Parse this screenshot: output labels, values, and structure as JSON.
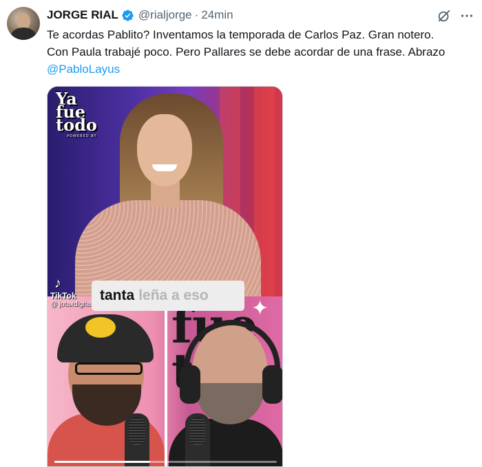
{
  "author": {
    "name": "JORGE RIAL",
    "handle": "@rialjorge",
    "separator": "·",
    "time": "24min"
  },
  "tweet": {
    "line1": "Te acordas Pablito? Inventamos la temporada de Carlos Paz. Gran notero.",
    "line2": "Con Paula trabajé poco. Pero Pallares se debe acordar de una frase. Abrazo",
    "mention": "@PabloLayus"
  },
  "media": {
    "logo_line1": "Ya",
    "logo_line2": "fue",
    "logo_line3": "todo",
    "logo_sub": "POWERED BY",
    "caption_dark": "tanta",
    "caption_light": "leña a eso",
    "watermark_brand": "TikTok",
    "watermark_user": "@ jotaxdigital",
    "progress": 0.43
  },
  "icons": {
    "verified": "verified-badge-icon",
    "grok": "grok-icon",
    "more": "more-options-icon",
    "tiktok": "tiktok-logo-icon"
  },
  "colors": {
    "link": "#1d9bf0",
    "verified": "#1d9bf0",
    "muted": "#536471"
  }
}
